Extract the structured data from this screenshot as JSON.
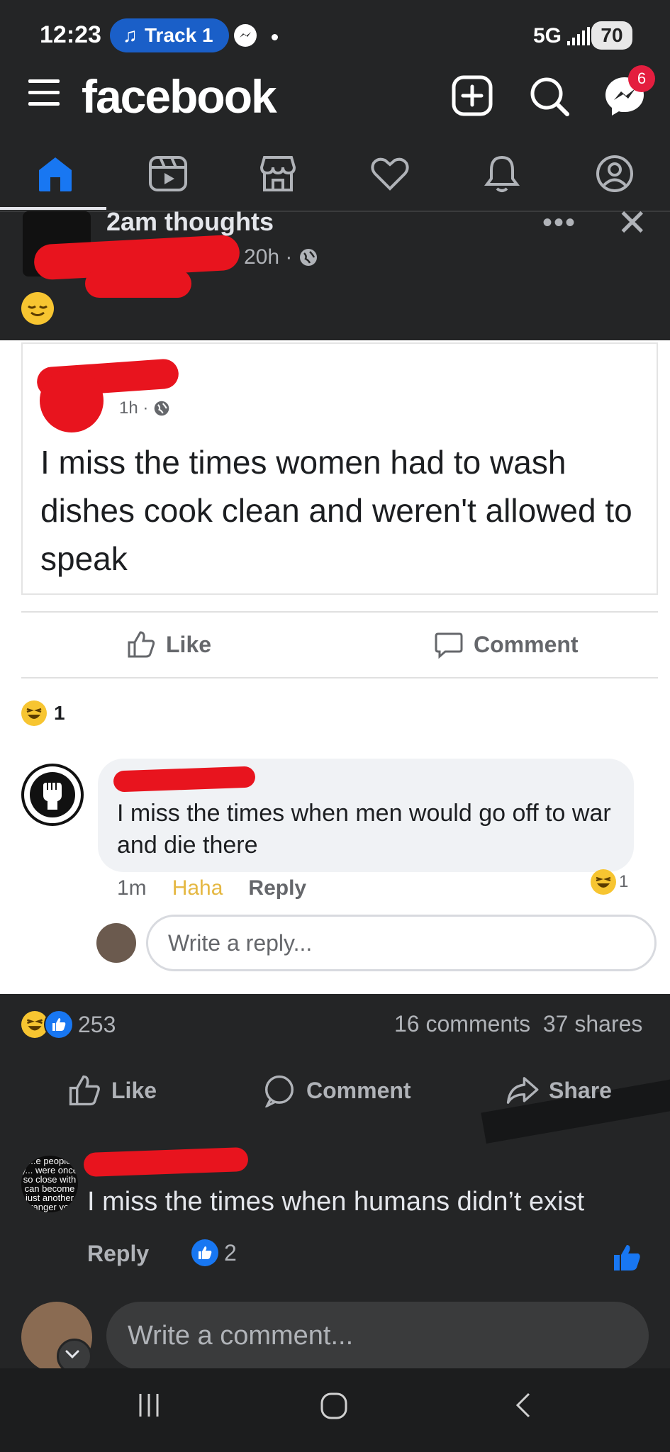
{
  "status_bar": {
    "time": "12:23",
    "media_label": "Track 1",
    "network": "5G",
    "battery": "70"
  },
  "header": {
    "logo": "facebook",
    "messenger_badge": "6"
  },
  "tabs": [
    {
      "name": "home",
      "icon": "home-icon",
      "active": true
    },
    {
      "name": "video",
      "icon": "video-icon"
    },
    {
      "name": "marketplace",
      "icon": "marketplace-icon"
    },
    {
      "name": "dating",
      "icon": "heart-icon"
    },
    {
      "name": "notifications",
      "icon": "bell-icon"
    },
    {
      "name": "profile",
      "icon": "profile-icon"
    }
  ],
  "post": {
    "title": "2am thoughts",
    "time": "20h",
    "privacy_icon": "globe-icon",
    "feeling_emoji": "relieved-emoji",
    "screenshot": {
      "inner_time": "1h",
      "inner_text": "I miss the times women had to wash dishes cook clean and weren't allowed to speak",
      "like_label": "Like",
      "comment_label": "Comment",
      "reaction_count": "1",
      "comment": {
        "text": "I miss the times when men would go off to war and die there",
        "time": "1m",
        "haha_label": "Haha",
        "reply_label": "Reply",
        "reaction_count": "1"
      },
      "reply_placeholder": "Write a reply..."
    },
    "reactions_count": "253",
    "comments_count": "16 comments",
    "shares_count": "37 shares",
    "actions": {
      "like": "Like",
      "comment": "Comment",
      "share": "Share"
    }
  },
  "comment": {
    "avatar_text": "...e people y... were once so close with can become just another stranger yo...",
    "text": "I miss the times when humans didn’t exist",
    "reply_label": "Reply",
    "like_count": "2"
  },
  "composer": {
    "placeholder": "Write a comment..."
  },
  "colors": {
    "bg": "#242526",
    "accent": "#1877f2",
    "redaction": "#e8141e"
  }
}
